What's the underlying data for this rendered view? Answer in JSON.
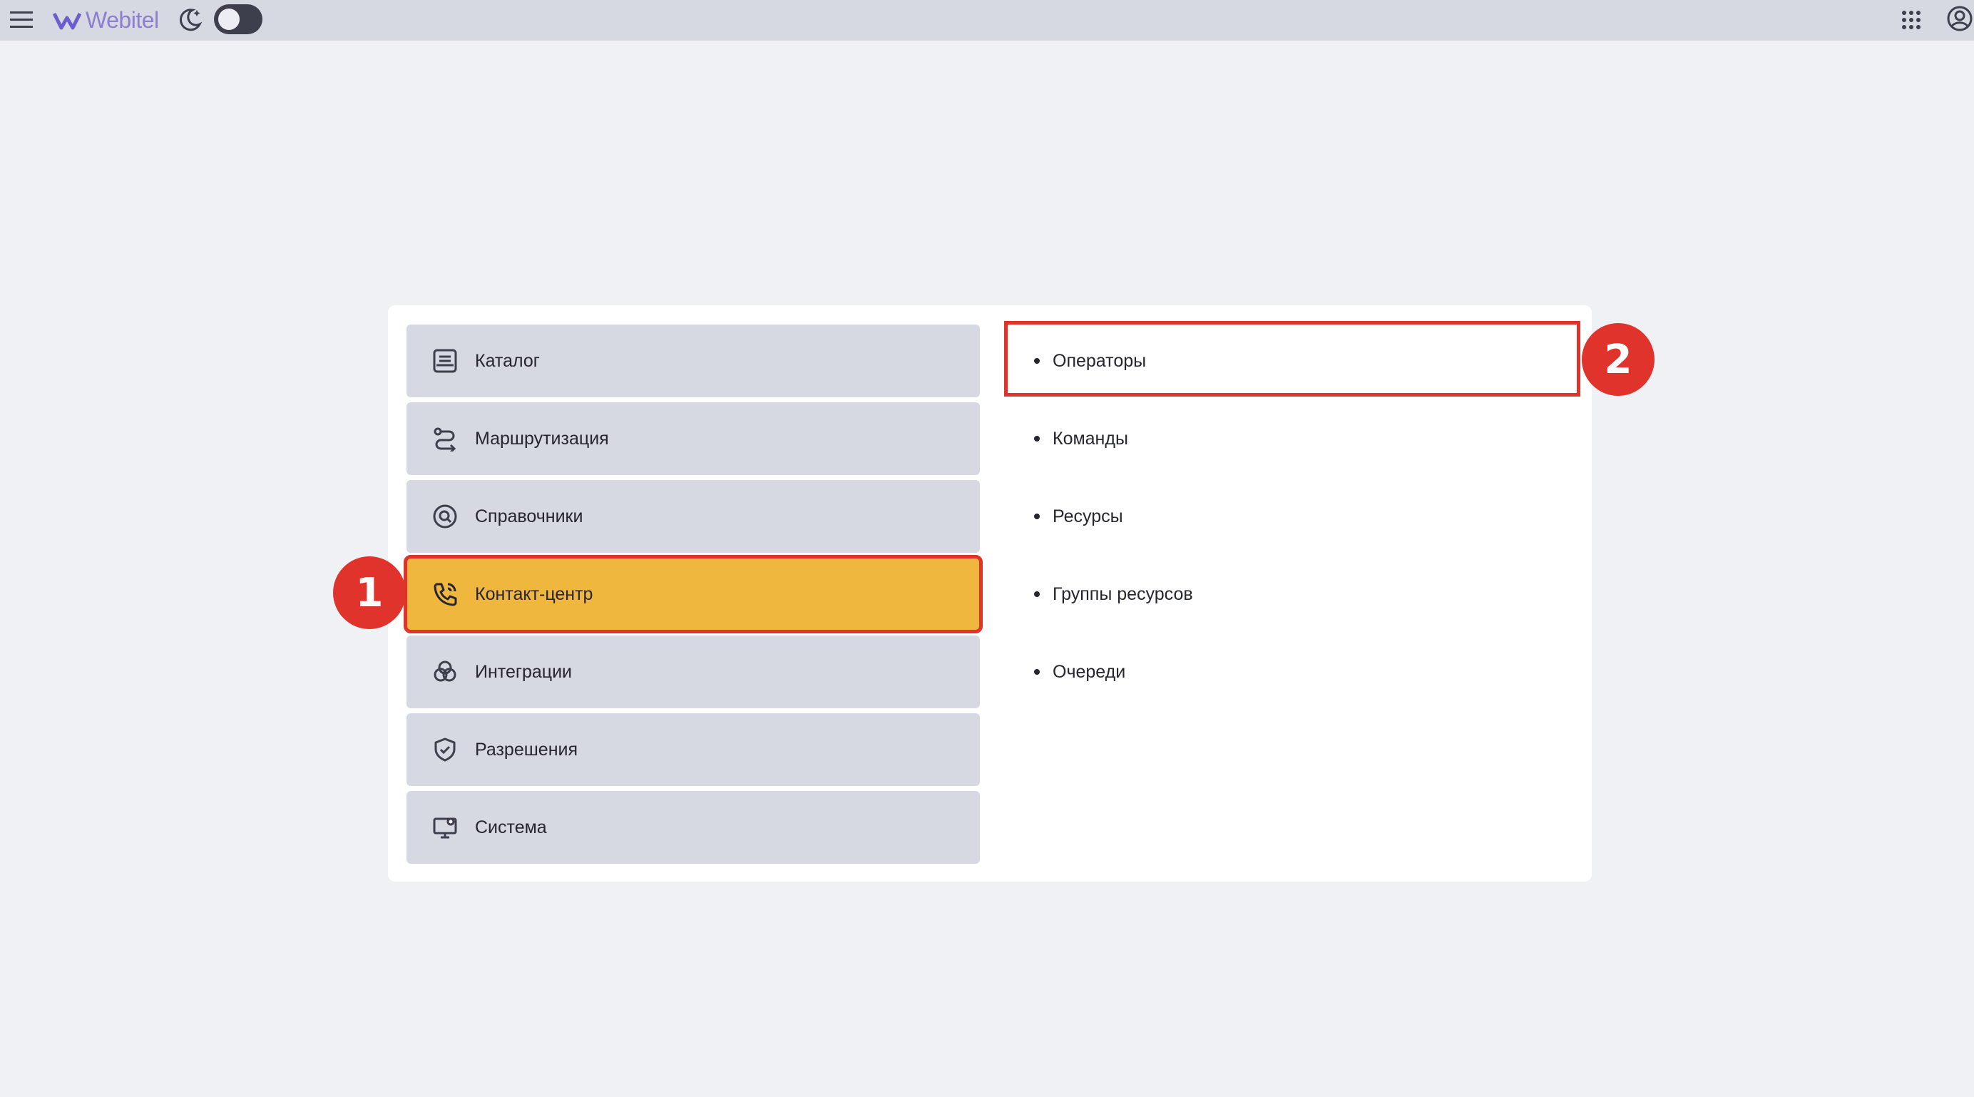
{
  "header": {
    "brand": "Webitel",
    "icons": {
      "menu": "hamburger-icon",
      "theme": "moon-icon",
      "apps": "apps-grid-icon",
      "account": "account-icon"
    },
    "theme_toggle_on": false
  },
  "menu": {
    "items": [
      {
        "label": "Каталог",
        "icon": "catalog-icon",
        "active": false
      },
      {
        "label": "Маршрутизация",
        "icon": "routing-icon",
        "active": false
      },
      {
        "label": "Справочники",
        "icon": "directory-icon",
        "active": false
      },
      {
        "label": "Контакт-центр",
        "icon": "phone-icon",
        "active": true
      },
      {
        "label": "Интеграции",
        "icon": "integrations-icon",
        "active": false
      },
      {
        "label": "Разрешения",
        "icon": "shield-icon",
        "active": false
      },
      {
        "label": "Система",
        "icon": "system-icon",
        "active": false
      }
    ]
  },
  "submenu": {
    "items": [
      {
        "label": "Операторы",
        "highlighted": true
      },
      {
        "label": "Команды",
        "highlighted": false
      },
      {
        "label": "Ресурсы",
        "highlighted": false
      },
      {
        "label": "Группы ресурсов",
        "highlighted": false
      },
      {
        "label": "Очереди",
        "highlighted": false
      }
    ]
  },
  "markers": [
    {
      "label": "1"
    },
    {
      "label": "2"
    }
  ],
  "colors": {
    "active_item": "#f0b73f",
    "highlight": "#e0332b",
    "menu_item_bg": "#d6d8e2"
  }
}
